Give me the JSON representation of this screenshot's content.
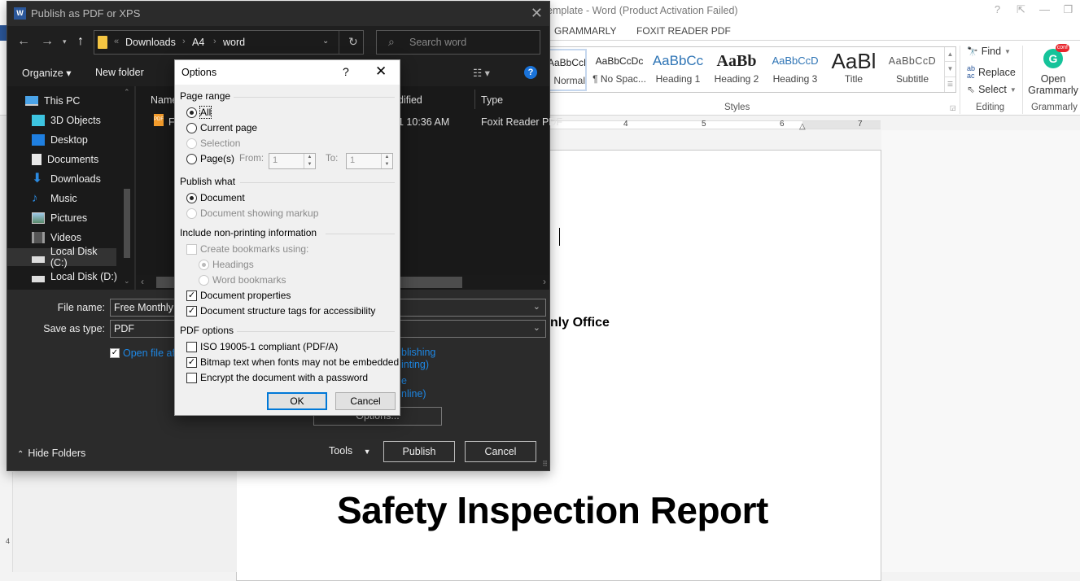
{
  "word": {
    "title": "emplate - Word (Product Activation Failed)",
    "window_buttons": [
      "?",
      "⇱",
      "—",
      "❐"
    ],
    "tabs": [
      "GRAMMARLY",
      "FOXIT READER PDF"
    ],
    "styles": [
      {
        "sample": "AaBbCcDc",
        "name": "Normal"
      },
      {
        "sample": "AaBbCcDc",
        "name": "¶ No Spac..."
      },
      {
        "sample": "AaBbCc",
        "name": "Heading 1"
      },
      {
        "sample": "AaBb",
        "name": "Heading 2"
      },
      {
        "sample": "AaBbCcD",
        "name": "Heading 3"
      },
      {
        "sample": "AaBl",
        "name": "Title"
      },
      {
        "sample": "AaBbCcD",
        "name": "Subtitle"
      }
    ],
    "groups": {
      "styles": "Styles",
      "editing": "Editing",
      "grammarly": "Grammarly"
    },
    "editing": {
      "find": "Find",
      "replace": "Replace",
      "select": "Select"
    },
    "grammarly": {
      "label_line1": "Open",
      "label_line2": "Grammarly",
      "badge": "conf",
      "logo": "G"
    },
    "ruler_numbers": [
      "4",
      "5",
      "6",
      "7"
    ],
    "vruler_number": "4",
    "document": {
      "partial_line": "nly Office",
      "heading": "Safety Inspection Report"
    }
  },
  "publish_dialog": {
    "title": "Publish as PDF or XPS",
    "address": {
      "overflow": "«",
      "crumbs": [
        "Downloads",
        "A4",
        "word"
      ]
    },
    "search_placeholder": "Search word",
    "toolbar": {
      "organize": "Organize ▾",
      "new_folder": "New folder"
    },
    "nav_items": [
      {
        "label": "This PC",
        "icon": "pc-icon"
      },
      {
        "label": "3D Objects",
        "icon": "cube-icon"
      },
      {
        "label": "Desktop",
        "icon": "desktop-icon"
      },
      {
        "label": "Documents",
        "icon": "documents-icon"
      },
      {
        "label": "Downloads",
        "icon": "download-arrow-icon"
      },
      {
        "label": "Music",
        "icon": "music-note-icon"
      },
      {
        "label": "Pictures",
        "icon": "pictures-icon"
      },
      {
        "label": "Videos",
        "icon": "film-icon"
      },
      {
        "label": "Local Disk (C:)",
        "icon": "drive-icon",
        "selected": true
      },
      {
        "label": "Local Disk (D:)",
        "icon": "drive-icon"
      }
    ],
    "columns": {
      "name": "Name",
      "modified": "dified",
      "type": "Type"
    },
    "file_row": {
      "name": "Fr",
      "modified": "1 10:36 AM",
      "type": "Foxit Reader PDF"
    },
    "file_name_label": "File name:",
    "file_name_value": "Free Monthly S",
    "save_type_label": "Save as type:",
    "save_type_value": "PDF",
    "open_after_label": "Open file aft",
    "open_after_checked": true,
    "optimize_links": [
      "blishing",
      "inting)",
      "e",
      "nline)"
    ],
    "options_button": "Options...",
    "hide_folders": "Hide Folders",
    "tools": "Tools",
    "publish": "Publish",
    "cancel": "Cancel"
  },
  "options_dialog": {
    "title": "Options",
    "help": "?",
    "page_range": {
      "label": "Page range",
      "all": "All",
      "current_page": "Current page",
      "selection": "Selection",
      "pages": "Page(s)",
      "from_label": "From:",
      "from_value": "1",
      "to_label": "To:",
      "to_value": "1",
      "selected": "all"
    },
    "publish_what": {
      "label": "Publish what",
      "document": "Document",
      "document_markup": "Document showing markup",
      "selected": "document"
    },
    "non_printing": {
      "label": "Include non-printing information",
      "create_bookmarks": "Create bookmarks using:",
      "create_bookmarks_checked": false,
      "headings": "Headings",
      "word_bookmarks": "Word bookmarks",
      "document_properties": "Document properties",
      "document_properties_checked": true,
      "structure_tags": "Document structure tags for accessibility",
      "structure_tags_checked": true
    },
    "pdf_options": {
      "label": "PDF options",
      "iso": "ISO 19005-1 compliant (PDF/A)",
      "iso_checked": false,
      "bitmap": "Bitmap text when fonts may not be embedded",
      "bitmap_checked": true,
      "encrypt": "Encrypt the document with a password",
      "encrypt_checked": false
    },
    "ok": "OK",
    "cancel": "Cancel"
  },
  "colors": {
    "word_blue": "#2b579a",
    "link_blue": "#1e88e5",
    "focus_blue": "#0078d7"
  }
}
